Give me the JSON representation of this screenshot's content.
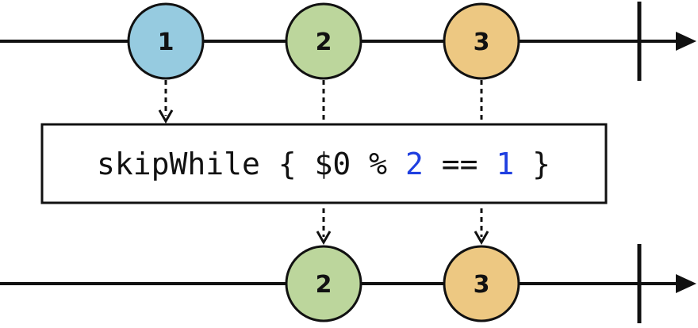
{
  "operator": {
    "parts": [
      {
        "text": "skipWhile { $0 % ",
        "kind": "code"
      },
      {
        "text": "2",
        "kind": "number"
      },
      {
        "text": " == ",
        "kind": "code"
      },
      {
        "text": "1",
        "kind": "number"
      },
      {
        "text": " }",
        "kind": "code"
      }
    ]
  },
  "input_stream": {
    "marbles": [
      {
        "label": "1",
        "color": "#96cbe0"
      },
      {
        "label": "2",
        "color": "#bcd69c"
      },
      {
        "label": "3",
        "color": "#edc882"
      }
    ],
    "completed": true
  },
  "output_stream": {
    "marbles": [
      {
        "label": "2",
        "color": "#bcd69c"
      },
      {
        "label": "3",
        "color": "#edc882"
      }
    ],
    "completed": true
  },
  "colors": {
    "line": "#111111",
    "number_token": "#1f3fe0"
  }
}
